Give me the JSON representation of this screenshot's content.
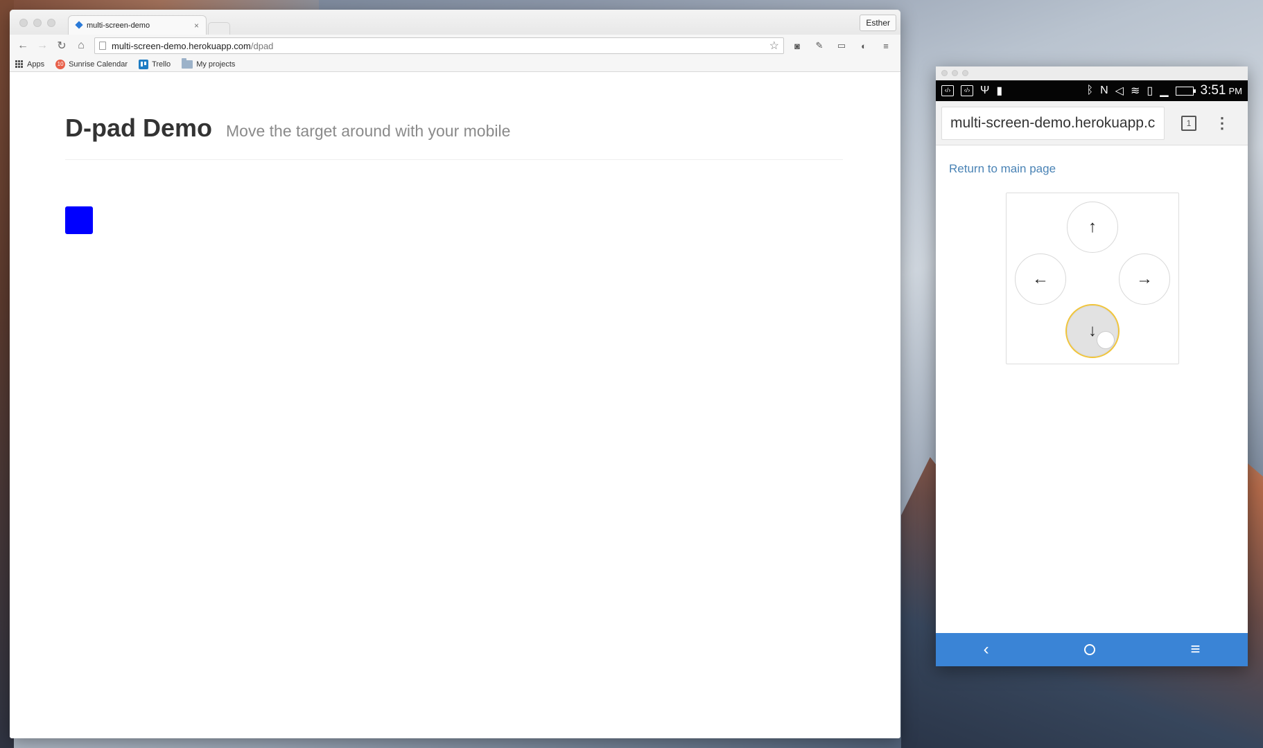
{
  "browser": {
    "tab_title": "multi-screen-demo",
    "tab_close": "×",
    "profile_name": "Esther",
    "url_host": "multi-screen-demo.herokuapp.com",
    "url_path": "/dpad",
    "bookmarks": [
      {
        "label": "Apps",
        "icon": "apps-grid-icon"
      },
      {
        "label": "Sunrise Calendar",
        "icon": "sunrise-calendar-icon",
        "badge": "10"
      },
      {
        "label": "Trello",
        "icon": "trello-icon"
      },
      {
        "label": "My projects",
        "icon": "folder-icon"
      }
    ]
  },
  "page": {
    "title": "D-pad Demo",
    "subtitle": "Move the target around with your mobile",
    "target_color": "#0000ff"
  },
  "phone": {
    "status_time": "3:51",
    "status_ampm": "PM",
    "url": "multi-screen-demo.herokuapp.c",
    "tab_count": "1",
    "return_link": "Return to main page",
    "dpad": {
      "up": "↑",
      "left": "←",
      "right": "→",
      "down": "↓",
      "pressed": "down"
    },
    "nav": {
      "back": "‹",
      "menu": "≡"
    },
    "accent": "#3a84d6"
  }
}
